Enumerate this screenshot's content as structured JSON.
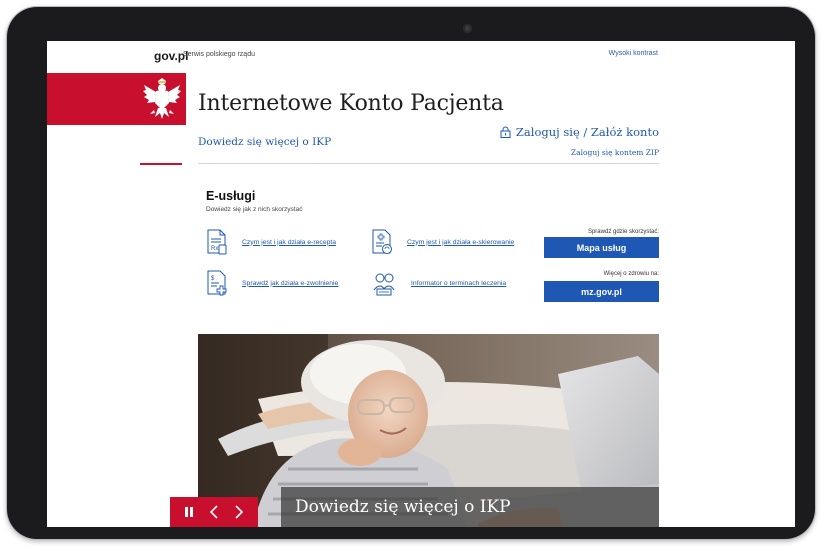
{
  "gov": {
    "logo": "gov.pl",
    "service": "Serwis polskiego rządu",
    "contrast": "Wysoki kontrast"
  },
  "header": {
    "title": "Internetowe Konto Pacjenta",
    "learn_more": "Dowiedz się więcej o IKP",
    "login": "Zaloguj się / Załóż konto",
    "login_zip": "Zaloguj się kontem ZIP"
  },
  "eservices": {
    "title": "E-usługi",
    "subtitle": "Dowiedz się jak z nich skorzystać",
    "items": [
      {
        "label": "Czym jest i jak działa e-recepta",
        "icon": "e-prescription-icon"
      },
      {
        "label": "Czym jest i jak działa e-skierowanie",
        "icon": "e-referral-icon"
      },
      {
        "label": "Sprawdź jak działa e-zwolnienie",
        "icon": "e-sick-leave-icon"
      },
      {
        "label": "Informator o terminach leczenia",
        "icon": "treatment-schedule-icon"
      }
    ],
    "cta1": {
      "label": "Sprawdź gdzie skorzystać:",
      "button": "Mapa usług"
    },
    "cta2": {
      "label": "Więcej o zdrowiu na:",
      "button": "mz.gov.pl"
    }
  },
  "hero": {
    "caption": "Dowiedz się więcej o IKP"
  },
  "colors": {
    "brand_red": "#c8102e",
    "link_blue": "#1f57b4"
  }
}
